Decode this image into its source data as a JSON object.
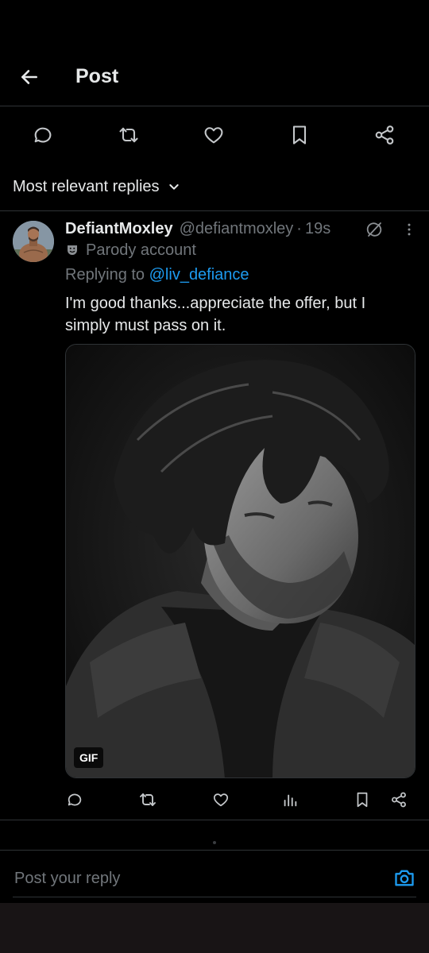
{
  "header": {
    "title": "Post"
  },
  "sort": {
    "label": "Most relevant replies"
  },
  "reply": {
    "author": {
      "display_name": "DefiantMoxley",
      "handle": "@defiantmoxley",
      "time": "19s",
      "separator": "·",
      "badge_label": "Parody account"
    },
    "replying_prefix": "Replying to ",
    "replying_to": "@liv_defiance",
    "text": "I'm good thanks...appreciate the offer, but I simply must pass on it.",
    "media": {
      "badge": "GIF"
    }
  },
  "composer": {
    "placeholder": "Post your reply"
  },
  "colors": {
    "background": "#000000",
    "text": "#e7e9ea",
    "muted": "#71767b",
    "accent": "#1d9bf0",
    "border": "#2f3336"
  },
  "icons": {
    "back": "arrow-left-icon",
    "reply": "speech-bubble-icon",
    "repost": "repost-icon",
    "like": "heart-icon",
    "bookmark": "bookmark-icon",
    "share": "share-icon",
    "views": "bar-chart-icon",
    "grok": "grok-icon",
    "more": "more-vertical-icon",
    "camera": "camera-icon",
    "parody": "theater-mask-icon"
  }
}
